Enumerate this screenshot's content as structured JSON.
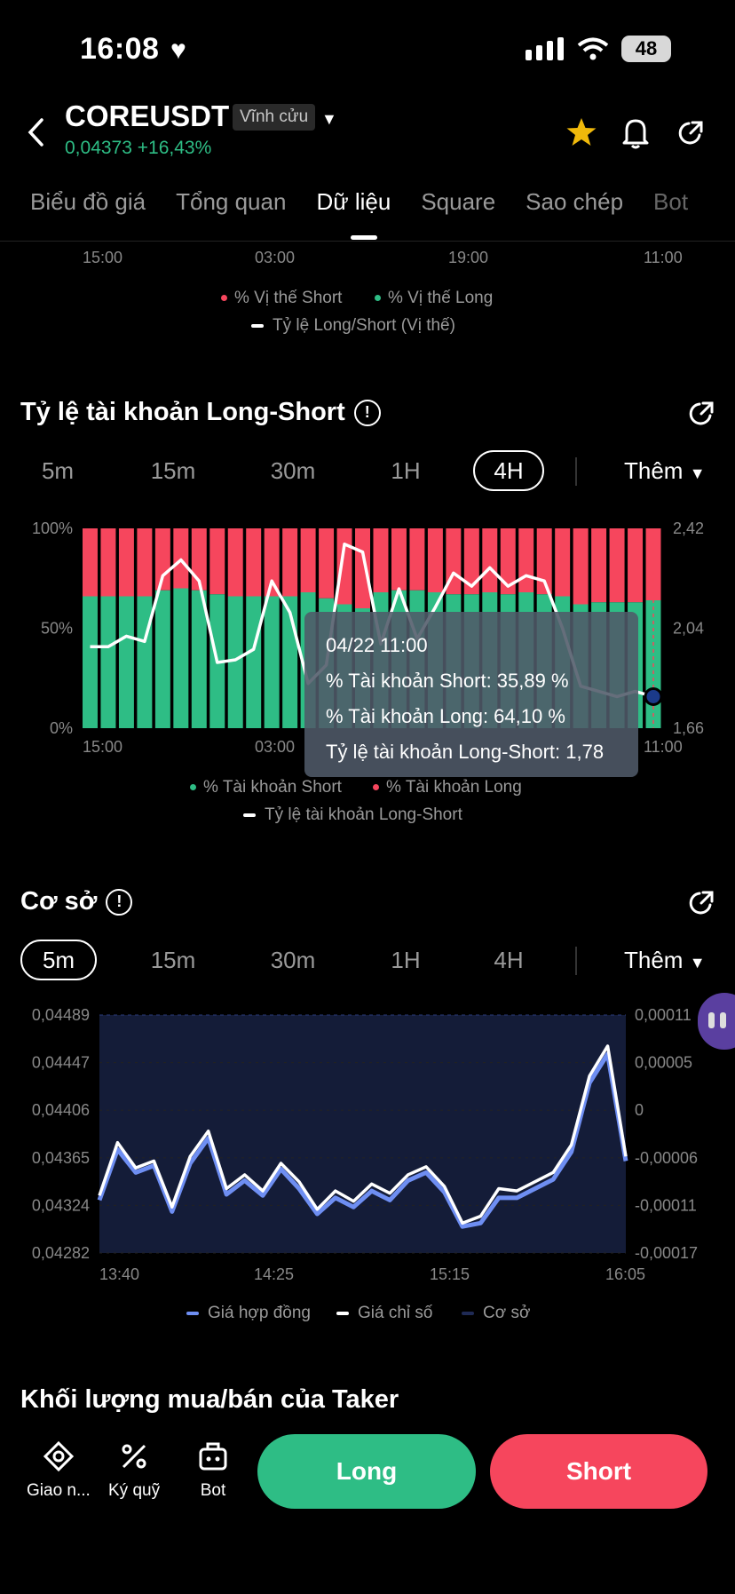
{
  "status": {
    "time": "16:08",
    "battery": "48"
  },
  "header": {
    "symbol": "COREUSDT",
    "badge": "Vĩnh cửu",
    "price": "0,04373",
    "change": "+16,43%"
  },
  "tabs": [
    "Biểu đồ giá",
    "Tổng quan",
    "Dữ liệu",
    "Square",
    "Sao chép",
    "Bot"
  ],
  "active_tab": "Dữ liệu",
  "prev_section": {
    "xticks": [
      "15:00",
      "03:00",
      "19:00",
      "11:00"
    ],
    "legend": [
      "% Vị thế Short",
      "% Vị thế Long",
      "Tỷ lệ Long/Short (Vị thế)"
    ]
  },
  "ls_section": {
    "title": "Tỷ lệ tài khoản Long-Short",
    "intervals": [
      "5m",
      "15m",
      "30m",
      "1H",
      "4H"
    ],
    "active_interval": "4H",
    "more": "Thêm",
    "legend": [
      "% Tài khoản Short",
      "% Tài khoản Long",
      "Tỷ lệ tài khoản Long-Short"
    ],
    "tooltip": {
      "date": "04/22 11:00",
      "short": "% Tài khoản Short: 35,89 %",
      "long": "% Tài khoản Long: 64,10 %",
      "ratio": "Tỷ lệ tài khoản Long-Short: 1,78"
    }
  },
  "basis_section": {
    "title": "Cơ sở",
    "intervals": [
      "5m",
      "15m",
      "30m",
      "1H",
      "4H"
    ],
    "active_interval": "5m",
    "more": "Thêm",
    "legend": [
      "Giá hợp đồng",
      "Giá chỉ số",
      "Cơ sở"
    ]
  },
  "taker_title": "Khối lượng mua/bán của Taker",
  "bottom": {
    "items": [
      "Giao n...",
      "Ký quỹ",
      "Bot"
    ],
    "long": "Long",
    "short": "Short"
  },
  "colors": {
    "green": "#2ebd85",
    "red": "#f6465d",
    "blue": "#6e8ef2",
    "basis_fill": "#141c38"
  },
  "chart_data": [
    {
      "type": "bar",
      "title": "Tỷ lệ tài khoản Long-Short",
      "x_ticks": [
        "15:00",
        "03:00",
        "11:00"
      ],
      "y_left_ticks": [
        "100%",
        "50%",
        "0%"
      ],
      "y_right_ticks": [
        "2,42",
        "2,04",
        "1,66"
      ],
      "ylim_left": [
        0,
        100
      ],
      "ylim_right": [
        1.66,
        2.42
      ],
      "series": [
        {
          "name": "% Tài khoản Long",
          "values": [
            66,
            66,
            66,
            66,
            69,
            70,
            69,
            67,
            66,
            66,
            66,
            66,
            68,
            65,
            62,
            60,
            68,
            69,
            69,
            68,
            67,
            67,
            68,
            67,
            68,
            67,
            66,
            62,
            63,
            63,
            63,
            64
          ]
        },
        {
          "name": "Tỷ lệ tài khoản Long-Short",
          "values": [
            1.97,
            1.97,
            2.01,
            1.99,
            2.24,
            2.3,
            2.22,
            1.91,
            1.92,
            1.96,
            2.22,
            2.1,
            1.83,
            1.9,
            2.36,
            2.33,
            1.98,
            2.19,
            2.0,
            2.12,
            2.25,
            2.2,
            2.27,
            2.2,
            2.24,
            2.22,
            2.04,
            1.82,
            1.8,
            1.78,
            1.8,
            1.78
          ]
        }
      ]
    },
    {
      "type": "line",
      "title": "Cơ sở",
      "x_ticks": [
        "13:40",
        "14:25",
        "15:15",
        "16:05"
      ],
      "y_left_ticks": [
        "0,04489",
        "0,04447",
        "0,04406",
        "0,04365",
        "0,04324",
        "0,04282"
      ],
      "y_right_ticks": [
        "0,00011",
        "0,00005",
        "0",
        "-0,00006",
        "-0,00011",
        "-0,00017"
      ],
      "ylim_left": [
        0.04282,
        0.04489
      ],
      "series": [
        {
          "name": "Giá hợp đồng",
          "values": [
            0.04328,
            0.04372,
            0.04352,
            0.04358,
            0.04318,
            0.0436,
            0.04382,
            0.04333,
            0.04345,
            0.04332,
            0.04355,
            0.04338,
            0.04316,
            0.0433,
            0.04322,
            0.04336,
            0.04328,
            0.04345,
            0.04352,
            0.04335,
            0.04305,
            0.04308,
            0.0433,
            0.0433,
            0.04338,
            0.04346,
            0.0437,
            0.0443,
            0.04455,
            0.04362
          ]
        },
        {
          "name": "Giá chỉ số",
          "values": [
            0.04332,
            0.04378,
            0.04356,
            0.04362,
            0.04322,
            0.04366,
            0.04388,
            0.04338,
            0.0435,
            0.04336,
            0.0436,
            0.04344,
            0.0432,
            0.04336,
            0.04327,
            0.04342,
            0.04334,
            0.0435,
            0.04357,
            0.0434,
            0.04308,
            0.04314,
            0.04338,
            0.04336,
            0.04344,
            0.04352,
            0.04376,
            0.04436,
            0.04462,
            0.04366
          ]
        }
      ]
    }
  ]
}
